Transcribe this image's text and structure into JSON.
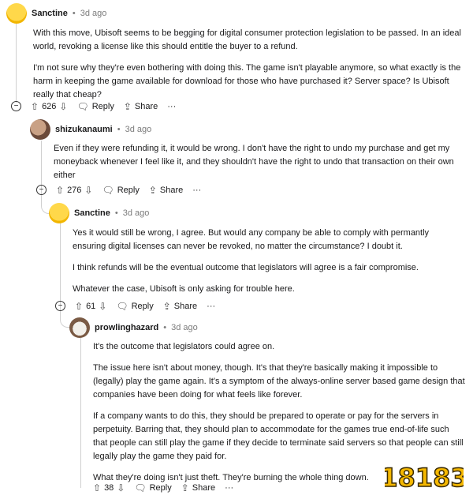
{
  "comments": [
    {
      "username": "Sanctine",
      "time": "3d ago",
      "paragraphs": [
        "With this move, Ubisoft seems to be begging for digital consumer protection legislation to be passed. In an ideal world, revoking a license like this should entitle the buyer to a refund.",
        "I'm not sure why they're even bothering with doing this. The game isn't playable anymore, so what exactly is the harm in keeping the game available for download for those who have purchased it? Server space? Is Ubisoft really that cheap?"
      ],
      "votes": "626",
      "reply": "Reply",
      "share": "Share",
      "more": "···"
    },
    {
      "username": "shizukanaumi",
      "time": "3d ago",
      "paragraphs": [
        "Even if they were refunding it, it would be wrong. I don't have the right to undo my purchase and get my moneyback whenever I feel like it, and they shouldn't have the right to undo that transaction on their own either"
      ],
      "votes": "276",
      "reply": "Reply",
      "share": "Share",
      "more": "···"
    },
    {
      "username": "Sanctine",
      "time": "3d ago",
      "paragraphs": [
        "Yes it would still be wrong, I agree. But would any company be able to comply with permantly ensuring digital licenses can never be revoked, no matter the circumstance? I doubt it.",
        "I think refunds will be the eventual outcome that legislators will agree is a fair compromise.",
        "Whatever the case, Ubisoft is only asking for trouble here."
      ],
      "votes": "61",
      "reply": "Reply",
      "share": "Share",
      "more": "···"
    },
    {
      "username": "prowlinghazard",
      "time": "3d ago",
      "paragraphs": [
        "It's the outcome that legislators could agree on.",
        "The issue here isn't about money, though. It's that they're basically making it impossible to (legally) play the game again. It's a symptom of the always-online server based game design that companies have been doing for what feels like forever.",
        "If a company wants to do this, they should be prepared to operate or pay for the servers in perpetuity. Barring that, they should plan to accommodate for the games true end-of-life such that people can still play the game if they decide to terminate said servers so that people can still legally play the game they paid for.",
        "What they're doing isn't just theft. They're burning the whole thing down."
      ],
      "votes": "38",
      "reply": "Reply",
      "share": "Share",
      "more": "···"
    }
  ],
  "icons": {
    "upvote": "upvote-icon",
    "downvote": "downvote-icon",
    "reply": "reply-icon",
    "share": "share-icon",
    "collapse": "collapse-icon"
  },
  "watermark": {
    "text": "18183"
  }
}
